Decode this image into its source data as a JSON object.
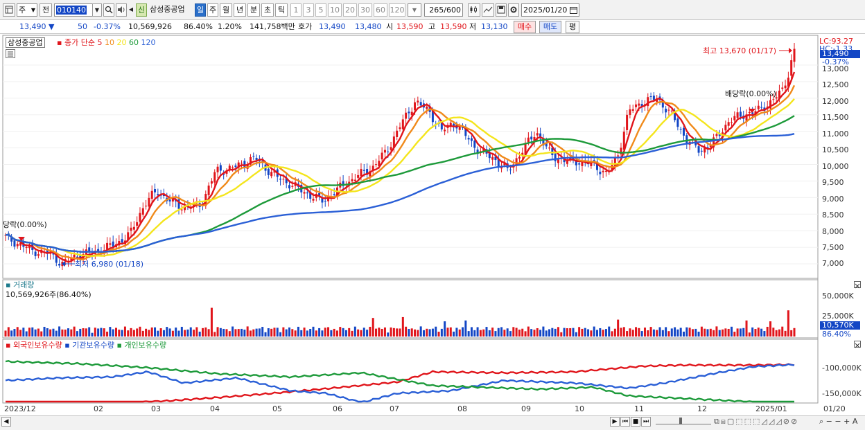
{
  "toolbar": {
    "market": "주",
    "prev_btn": "전",
    "code": "010140",
    "new_badge": "신",
    "stock_name": "삼성중공업",
    "periods": [
      "일",
      "주",
      "월",
      "년",
      "분",
      "초",
      "틱"
    ],
    "period_active": "일",
    "intervals": [
      "1",
      "3",
      "5",
      "10",
      "20",
      "30",
      "60",
      "120"
    ],
    "count": "265",
    "count_max": "/600",
    "date": "2025/01/20"
  },
  "quote": {
    "price": "13,490",
    "change": "50",
    "change_pct": "-0.37%",
    "volume": "10,569,926",
    "vol_ratio": "86.40%",
    "turnover": "1.20%",
    "amount": "141,758백만",
    "bid_label": "호가",
    "ask": "13,490",
    "bid": "13,480",
    "open_label": "시",
    "open": "13,590",
    "high_label": "고",
    "high": "13,590",
    "low_label": "저",
    "low": "13,130",
    "buy_btn": "매수",
    "sell_btn": "매도",
    "flat_btn": "평"
  },
  "price_panel": {
    "title": "삼성중공업",
    "ma_label": "종가 단순",
    "ma_periods": [
      "5",
      "10",
      "20",
      "60",
      "120"
    ],
    "ma_colors": [
      "#e0151b",
      "#f08a1a",
      "#f4e51c",
      "#1d9a3a",
      "#2a5fd6"
    ],
    "y_ticks": [
      "13,000",
      "12,500",
      "12,000",
      "11,500",
      "11,000",
      "10,500",
      "10,000",
      "9,500",
      "9,000",
      "8,500",
      "8,000",
      "7,500",
      "7,000"
    ],
    "current_price": "13,490",
    "current_pct": "-0.37%",
    "lc_label": "LC:93.27",
    "hc_label": "HC:-1.33",
    "high_note": "최고 13,670 (01/17)",
    "low_note": "최저 6,980 (01/18)",
    "dividend_note_left": "당락(0.00%)",
    "dividend_note_right": "배당락(0.00%)"
  },
  "volume_panel": {
    "title": "거래량",
    "value": "10,569,926주(86.40%)",
    "y_ticks": [
      "50,000K",
      "25,000K"
    ],
    "current": "10,570K",
    "current_pct": "86.40%"
  },
  "holding_panel": {
    "series": [
      "외국인보유수량",
      "기관보유수량",
      "개인보유수량"
    ],
    "series_colors": [
      "#e0151b",
      "#2a5fd6",
      "#1d9a3a"
    ],
    "y_ticks": [
      "-100,000K",
      "-150,000K"
    ]
  },
  "x_axis": {
    "labels": [
      "2023/12",
      "02",
      "03",
      "04",
      "05",
      "06",
      "07",
      "08",
      "09",
      "10",
      "11",
      "12",
      "2025/01"
    ],
    "right_label": "01/20"
  },
  "colors": {
    "up": "#e0151b",
    "down": "#1346c5",
    "accent": "#2a6fc9"
  }
}
